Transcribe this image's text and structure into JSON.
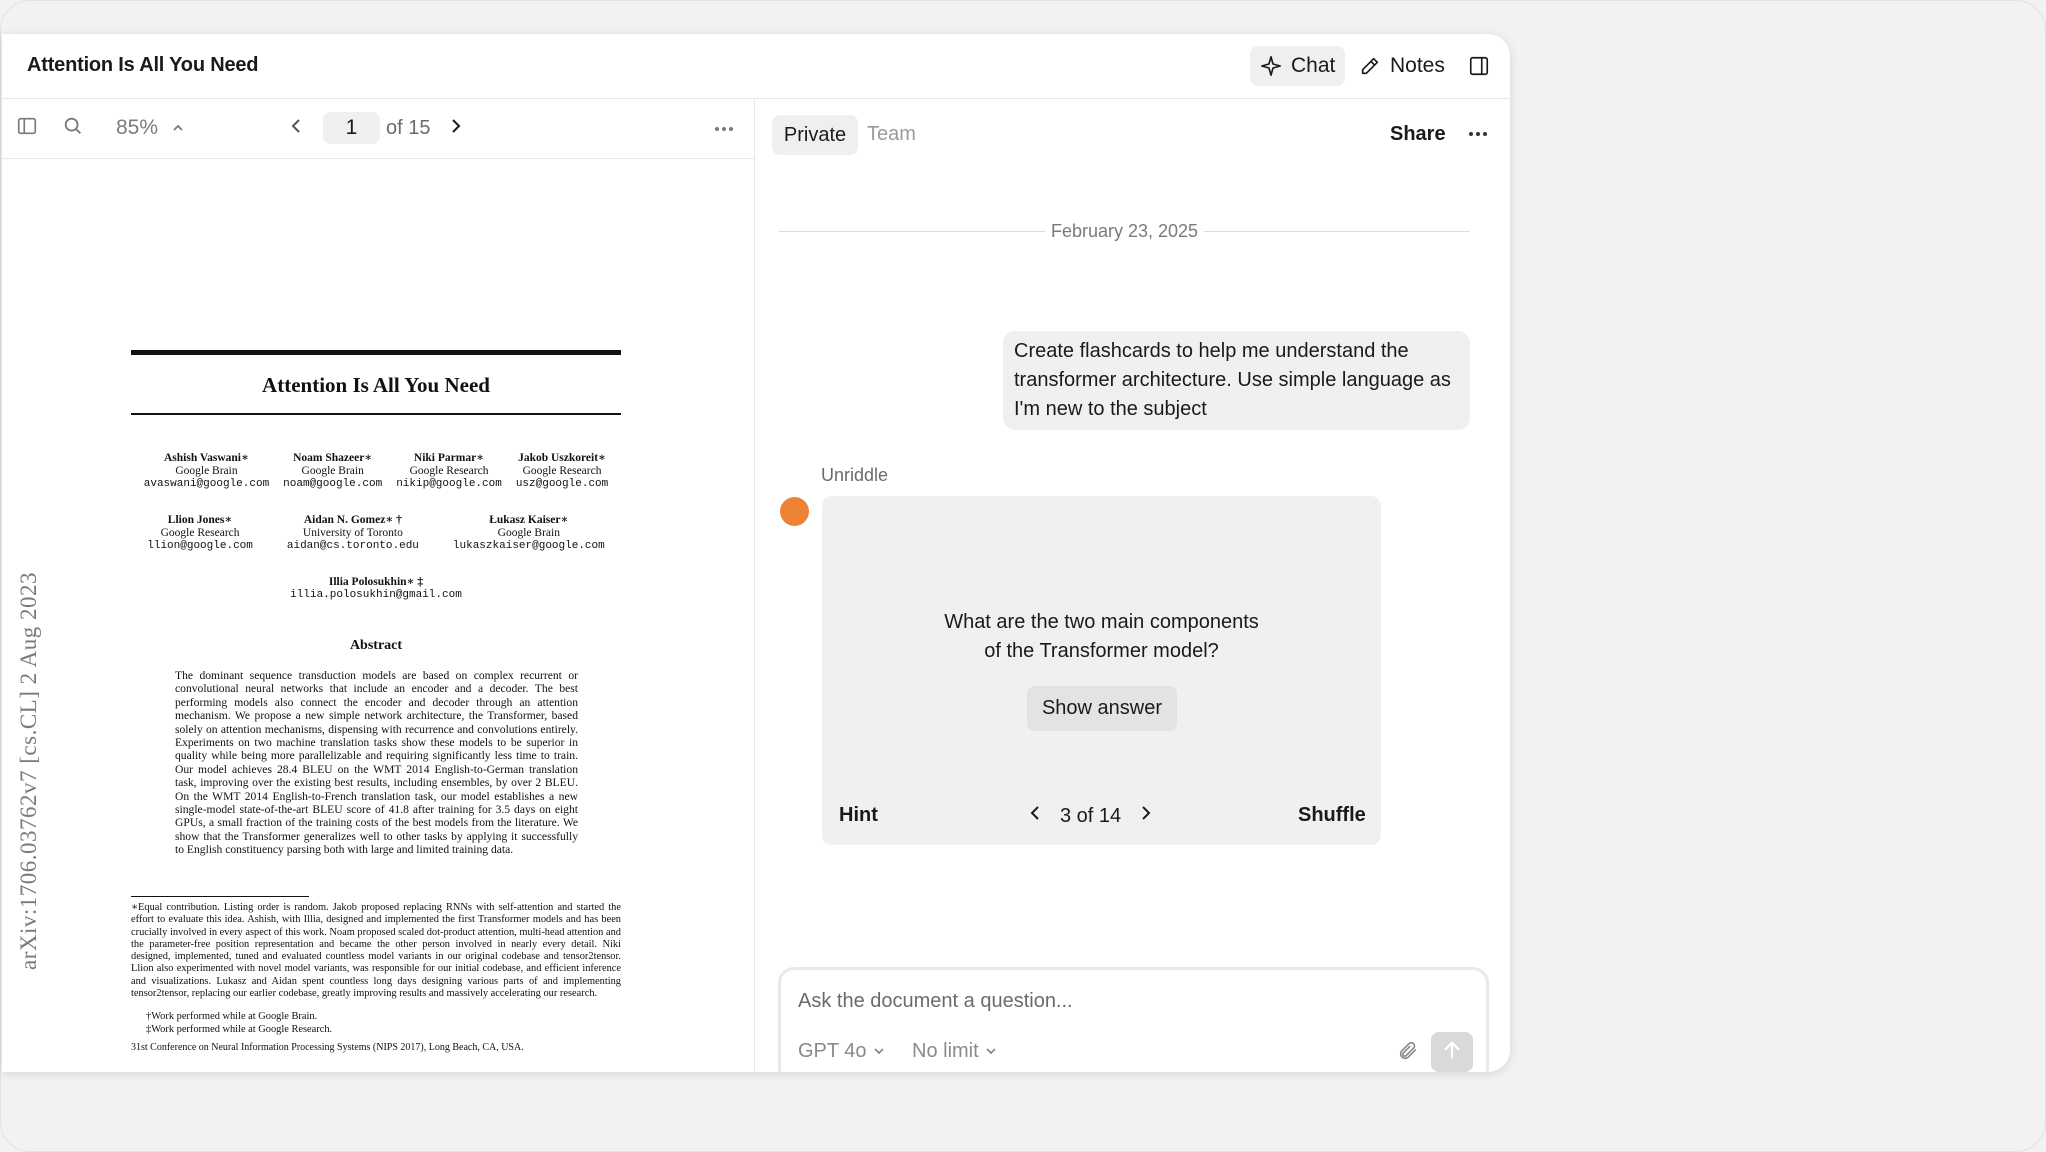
{
  "header": {
    "doc_title": "Attention Is All You Need",
    "chat_label": "Chat",
    "notes_label": "Notes"
  },
  "pdf_toolbar": {
    "zoom": "85%",
    "page_current": "1",
    "page_total": "of 15"
  },
  "pdf": {
    "side_label": "arXiv:1706.03762v7  [cs.CL]  2 Aug 2023",
    "title": "Attention Is All You Need",
    "authors": [
      {
        "name": "Ashish Vaswani∗",
        "affil": "Google Brain",
        "email": "avaswani@google.com"
      },
      {
        "name": "Noam Shazeer∗",
        "affil": "Google Brain",
        "email": "noam@google.com"
      },
      {
        "name": "Niki Parmar∗",
        "affil": "Google Research",
        "email": "nikip@google.com"
      },
      {
        "name": "Jakob Uszkoreit∗",
        "affil": "Google Research",
        "email": "usz@google.com"
      },
      {
        "name": "Llion Jones∗",
        "affil": "Google Research",
        "email": "llion@google.com"
      },
      {
        "name": "Aidan N. Gomez∗ †",
        "affil": "University of Toronto",
        "email": "aidan@cs.toronto.edu"
      },
      {
        "name": "Łukasz Kaiser∗",
        "affil": "Google Brain",
        "email": "lukaszkaiser@google.com"
      },
      {
        "name": "Illia Polosukhin∗ ‡",
        "affil": "",
        "email": "illia.polosukhin@gmail.com"
      }
    ],
    "abstract_heading": "Abstract",
    "abstract": "The dominant sequence transduction models are based on complex recurrent or convolutional neural networks that include an encoder and a decoder. The best performing models also connect the encoder and decoder through an attention mechanism. We propose a new simple network architecture, the Transformer, based solely on attention mechanisms, dispensing with recurrence and convolutions entirely. Experiments on two machine translation tasks show these models to be superior in quality while being more parallelizable and requiring significantly less time to train. Our model achieves 28.4 BLEU on the WMT 2014 English-to-German translation task, improving over the existing best results, including ensembles, by over 2 BLEU. On the WMT 2014 English-to-French translation task, our model establishes a new single-model state-of-the-art BLEU score of 41.8 after training for 3.5 days on eight GPUs, a small fraction of the training costs of the best models from the literature. We show that the Transformer generalizes well to other tasks by applying it successfully to English constituency parsing both with large and limited training data.",
    "footnote_main": "∗Equal contribution. Listing order is random. Jakob proposed replacing RNNs with self-attention and started the effort to evaluate this idea. Ashish, with Illia, designed and implemented the first Transformer models and has been crucially involved in every aspect of this work. Noam proposed scaled dot-product attention, multi-head attention and the parameter-free position representation and became the other person involved in nearly every detail. Niki designed, implemented, tuned and evaluated countless model variants in our original codebase and tensor2tensor. Llion also experimented with novel model variants, was responsible for our initial codebase, and efficient inference and visualizations. Lukasz and Aidan spent countless long days designing various parts of and implementing tensor2tensor, replacing our earlier codebase, greatly improving results and massively accelerating our research.",
    "footnote_dagger": "†Work performed while at Google Brain.",
    "footnote_ddagger": "‡Work performed while at Google Research.",
    "conference": "31st Conference on Neural Information Processing Systems (NIPS 2017), Long Beach, CA, USA."
  },
  "chat": {
    "tab_private": "Private",
    "tab_team": "Team",
    "share_label": "Share",
    "more_label": "···",
    "date": "February 23, 2025",
    "user_message": "Create flashcards to help me understand the transformer architecture. Use simple language as I'm new to the subject",
    "bot_name": "Unriddle",
    "avatar_color": "#ee8433",
    "flashcard": {
      "question_line1": "What are the two main components",
      "question_line2": "of the Transformer model?",
      "show_answer": "Show answer",
      "hint": "Hint",
      "position": "3 of 14",
      "shuffle": "Shuffle"
    },
    "composer": {
      "placeholder": "Ask the document a question...",
      "model": "GPT 4o",
      "limit": "No limit"
    }
  }
}
